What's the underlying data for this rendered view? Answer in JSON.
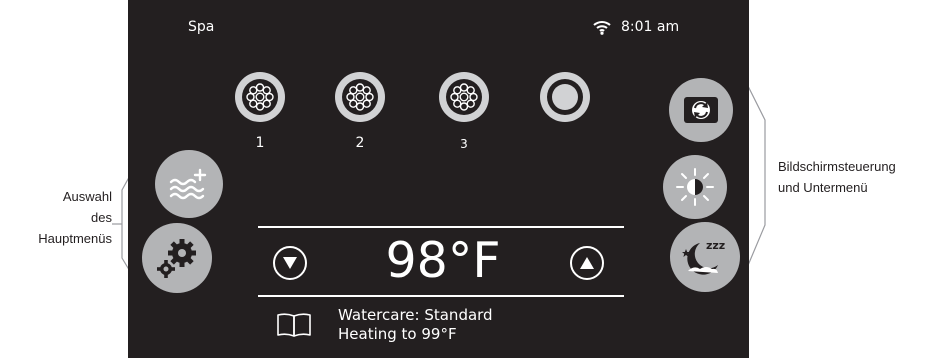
{
  "status_bar": {
    "title": "Spa",
    "time": "8:01 am"
  },
  "pumps": [
    {
      "label": "1",
      "icon": "jet-icon"
    },
    {
      "label": "2",
      "icon": "jet-icon"
    },
    {
      "label": "3",
      "icon": "jet-icon"
    },
    {
      "label": "",
      "icon": "light-ring-icon"
    }
  ],
  "temperature": {
    "current": "98°F"
  },
  "status_info": {
    "line1": "Watercare: Standard",
    "line2": "Heating to 99°F"
  },
  "annotations": {
    "left_line1": "Auswahl",
    "left_line2": "des",
    "left_line3": "Hauptmenüs",
    "right_line1": "Bildschirmsteuerung",
    "right_line2": "und Untermenü"
  },
  "colors": {
    "screen_bg": "#231f20",
    "button_grey": "#b3b4b6",
    "pump_grey": "#d1d2d4",
    "accent": "#ffffff"
  }
}
